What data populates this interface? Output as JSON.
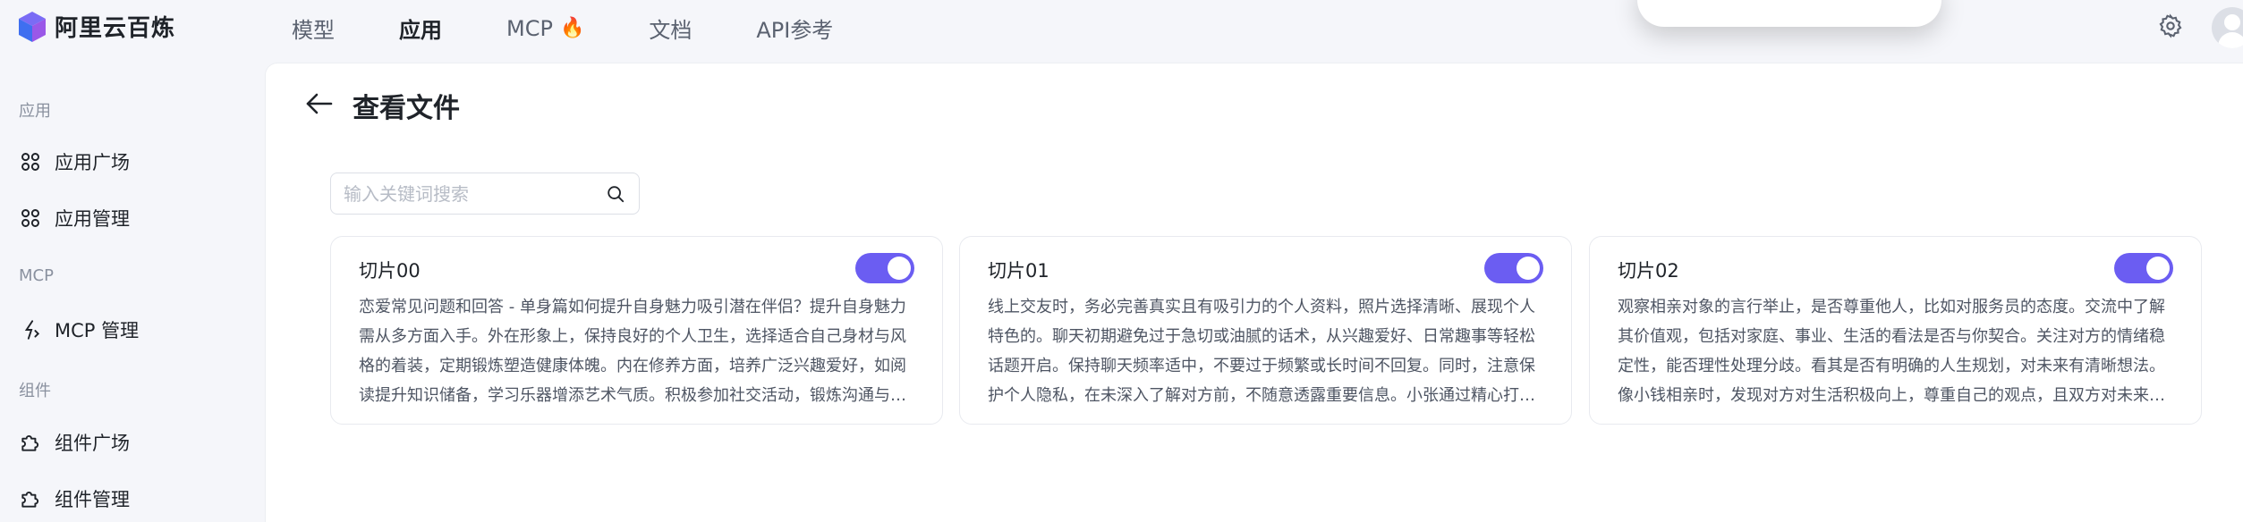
{
  "app": {
    "name": "阿里云百炼"
  },
  "topnav": {
    "items": [
      {
        "label": "模型"
      },
      {
        "label": "应用"
      },
      {
        "label": "MCP",
        "icon": "flame-icon"
      },
      {
        "label": "文档"
      },
      {
        "label": "API参考"
      }
    ],
    "active": "应用"
  },
  "sidebar": {
    "groups": [
      {
        "label": "应用",
        "items": [
          {
            "label": "应用广场",
            "icon": "grid-icon"
          },
          {
            "label": "应用管理",
            "icon": "grid-icon"
          }
        ]
      },
      {
        "label": "MCP",
        "items": [
          {
            "label": "MCP 管理",
            "icon": "spark-icon"
          }
        ]
      },
      {
        "label": "组件",
        "items": [
          {
            "label": "组件广场",
            "icon": "puzzle-icon"
          },
          {
            "label": "组件管理",
            "icon": "puzzle-icon"
          }
        ]
      }
    ]
  },
  "page": {
    "title": "查看文件"
  },
  "search": {
    "placeholder": "输入关键词搜索",
    "value": ""
  },
  "cards": [
    {
      "title": "切片00",
      "enabled": true,
      "text": "恋爱常见问题和回答 - 单身篇如何提升自身魅力吸引潜在伴侣？提升自身魅力需从多方面入手。外在形象上，保持良好的个人卫生，选择适合自己身材与风格的着装，定期锻炼塑造健康体魄。内在修养方面，培养广泛兴趣爱好，如阅读提升知识储备，学习乐器增添艺术气质。积极参加社交活动，锻炼沟通与…"
    },
    {
      "title": "切片01",
      "enabled": true,
      "text": "线上交友时，务必完善真实且有吸引力的个人资料，照片选择清晰、展现个人特色的。聊天初期避免过于急切或油腻的话术，从兴趣爱好、日常趣事等轻松话题开启。保持聊天频率适中，不要过于频繁或长时间不回复。同时，注意保护个人隐私，在未深入了解对方前，不随意透露重要信息。小张通过精心打…"
    },
    {
      "title": "切片02",
      "enabled": true,
      "text": "观察相亲对象的言行举止，是否尊重他人，比如对服务员的态度。交流中了解其价值观，包括对家庭、事业、生活的看法是否与你契合。关注对方的情绪稳定性，能否理性处理分歧。看其是否有明确的人生规划，对未来有清晰想法。像小钱相亲时，发现对方对生活积极向上，尊重自己的观点，且双方对未来…"
    }
  ],
  "colors": {
    "accent": "#6b5df2",
    "background": "#f5f6fa"
  }
}
